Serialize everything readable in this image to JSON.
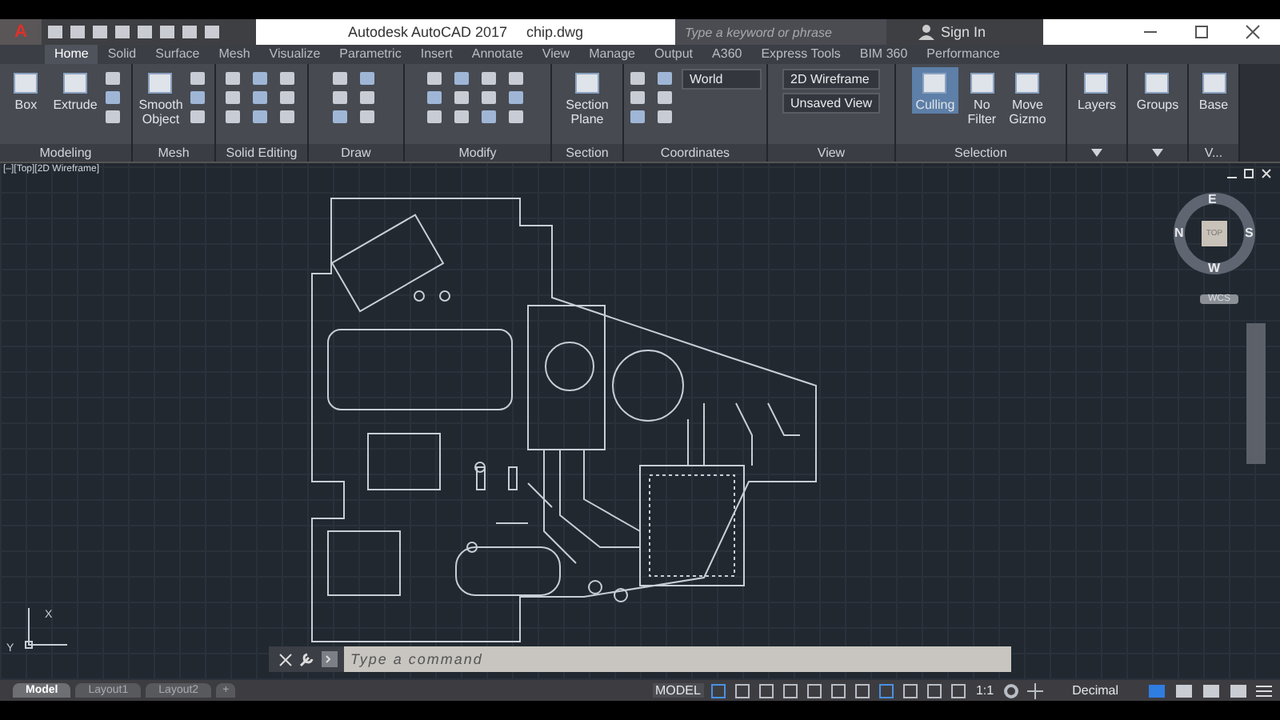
{
  "title_bar": {
    "app_button": "A",
    "app": "Autodesk AutoCAD 2017",
    "file": "chip.dwg",
    "search": {
      "placeholder": "Type a keyword or phrase"
    },
    "sign_in": "Sign In"
  },
  "tabs": [
    {
      "label": "Home",
      "selected": true
    },
    {
      "label": "Solid",
      "selected": false
    },
    {
      "label": "Surface",
      "selected": false
    },
    {
      "label": "Mesh",
      "selected": false
    },
    {
      "label": "Visualize",
      "selected": false
    },
    {
      "label": "Parametric",
      "selected": false
    },
    {
      "label": "Insert",
      "selected": false
    },
    {
      "label": "Annotate",
      "selected": false
    },
    {
      "label": "View",
      "selected": false
    },
    {
      "label": "Manage",
      "selected": false
    },
    {
      "label": "Output",
      "selected": false
    },
    {
      "label": "A360",
      "selected": false
    },
    {
      "label": "Express Tools",
      "selected": false
    },
    {
      "label": "BIM 360",
      "selected": false
    },
    {
      "label": "Performance",
      "selected": false
    }
  ],
  "panels": [
    {
      "title": "Modeling",
      "buttons": [
        {
          "label": "Box",
          "on": false
        },
        {
          "label": "Extrude",
          "on": false
        }
      ]
    },
    {
      "title": "Mesh",
      "buttons": [
        {
          "label": "Smooth Object",
          "on": false
        }
      ]
    },
    {
      "title": "Solid Editing"
    },
    {
      "title": "Draw"
    },
    {
      "title": "Modify"
    },
    {
      "title": "Section",
      "buttons": [
        {
          "label": "Section Plane",
          "on": false
        }
      ]
    },
    {
      "title": "Coordinates",
      "dropdowns": [
        "World"
      ]
    },
    {
      "title": "View",
      "dropdowns": [
        "2D Wireframe",
        "Unsaved View"
      ]
    },
    {
      "title": "Selection",
      "buttons": [
        {
          "label": "Culling",
          "on": true
        },
        {
          "label": "No Filter",
          "on": false
        },
        {
          "label": "Move Gizmo",
          "on": false
        }
      ]
    },
    {
      "buttons": [
        {
          "label": "Layers",
          "on": false
        }
      ]
    },
    {
      "buttons": [
        {
          "label": "Groups",
          "on": false
        }
      ]
    },
    {
      "title": "V...",
      "buttons": [
        {
          "label": "Base",
          "on": false
        }
      ]
    }
  ],
  "viewport": {
    "label": "[–][Top][2D Wireframe]",
    "compass": {
      "north": "N",
      "east": "E",
      "south": "S",
      "west": "W",
      "face": "TOP"
    },
    "ucs": "WCS",
    "axis": {
      "x": "X",
      "y": "Y"
    }
  },
  "command_line": {
    "placeholder": "Type a command"
  },
  "layout_tabs": [
    {
      "label": "Model",
      "selected": true
    },
    {
      "label": "Layout1",
      "selected": false
    },
    {
      "label": "Layout2",
      "selected": false
    }
  ],
  "add_tab": "+",
  "status_bar": {
    "space": "MODEL",
    "scale": "1:1",
    "units": "Decimal"
  }
}
